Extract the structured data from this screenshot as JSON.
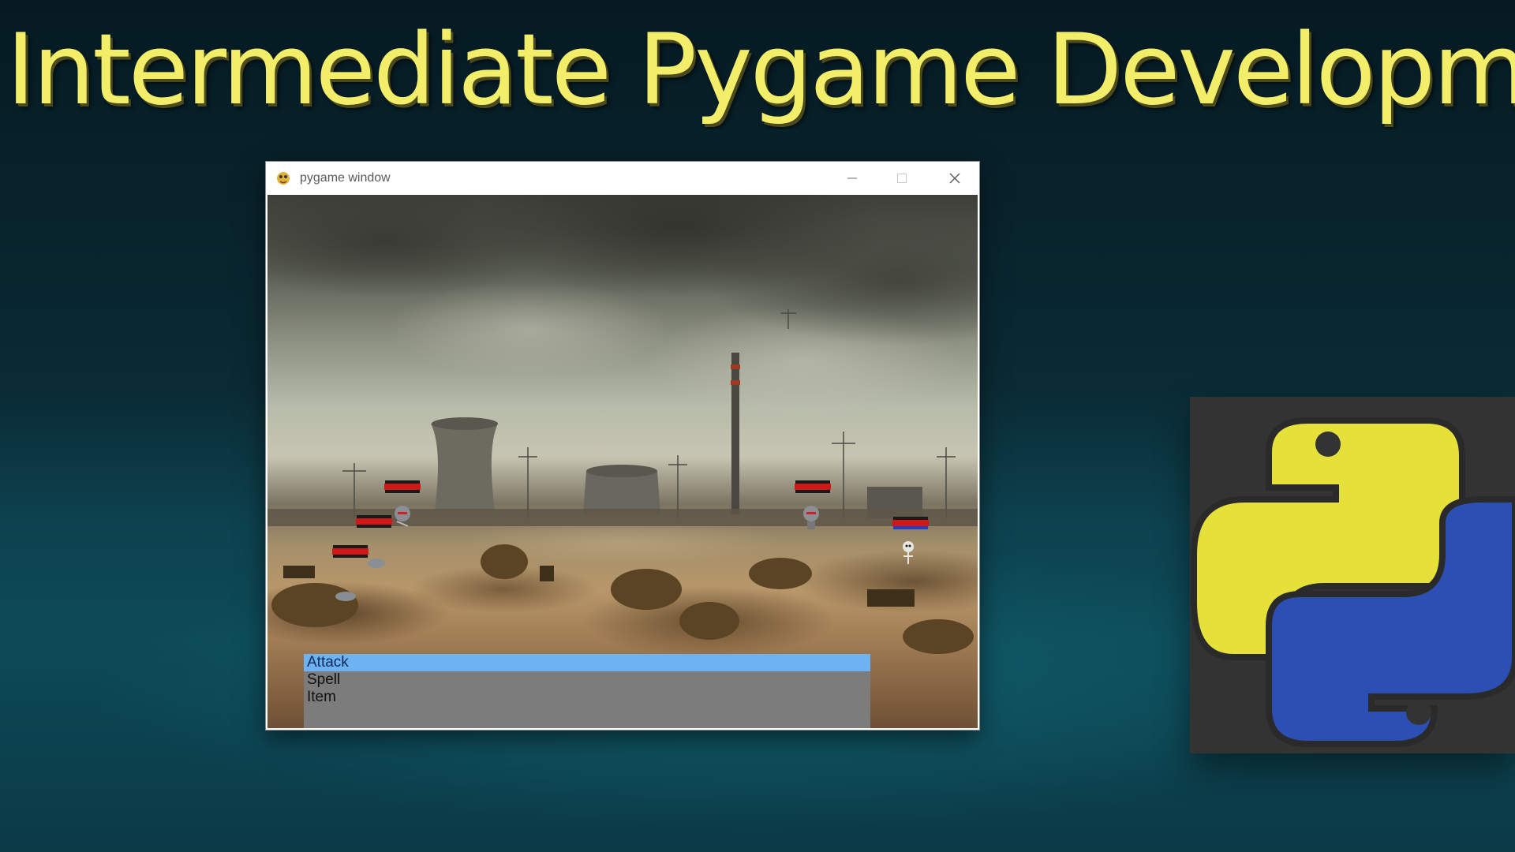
{
  "slide": {
    "title": "Intermediate Pygame Development"
  },
  "window": {
    "title": "pygame window",
    "icon": "pygame-snake-icon",
    "controls": [
      "minimize-icon",
      "maximize-icon",
      "close-icon"
    ]
  },
  "game": {
    "background": "post-apocalyptic industrial wasteland with cooling towers",
    "menu": {
      "items": [
        {
          "label": "Attack",
          "selected": true
        },
        {
          "label": "Spell",
          "selected": false
        },
        {
          "label": "Item",
          "selected": false
        }
      ]
    },
    "health_bars": [
      {
        "side": "player",
        "hp_fraction": 1.0
      },
      {
        "side": "player",
        "hp_fraction": 1.0
      },
      {
        "side": "player",
        "hp_fraction": 1.0
      },
      {
        "side": "enemy",
        "hp_fraction": 1.0
      },
      {
        "side": "enemy",
        "hp_fraction": 1.0
      }
    ]
  },
  "logo": {
    "name": "python-logo",
    "colors": {
      "yellow": "#e8e23c",
      "blue": "#2d4fb2",
      "panel": "#333333"
    }
  },
  "colors": {
    "title": "#f3ee6a",
    "menu_bg": "#7c7c7c",
    "menu_selected": "#6fb2f2",
    "hp_red": "#d01818"
  }
}
